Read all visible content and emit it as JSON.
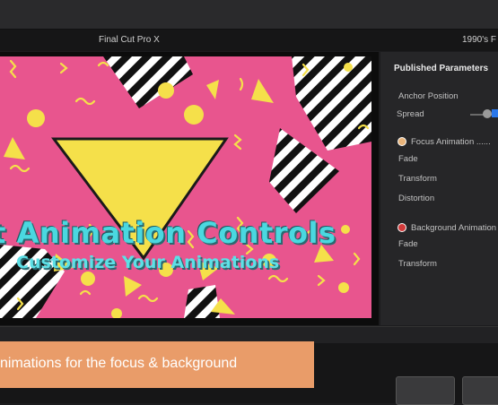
{
  "window": {
    "app_title": "Final Cut Pro X",
    "project_title": "1990's F"
  },
  "viewer": {
    "title": "xt Animation Controls",
    "subtitle": "Customize Your Animations"
  },
  "inspector": {
    "header": "Published Parameters",
    "rows": {
      "anchor_position": "Anchor Position",
      "spread": "Spread",
      "focus_animation": "Focus Animation",
      "focus_fade": "Fade",
      "focus_transform": "Transform",
      "focus_distortion": "Distortion",
      "background_animation": "Background Animation",
      "bg_fade": "Fade",
      "bg_transform": "Transform"
    }
  },
  "caption": {
    "text": "nimations for the focus & background"
  },
  "colors": {
    "canvas_pink": "#e8558e",
    "accent_yellow": "#f5e04a",
    "title_cyan": "#4ad8e0",
    "caption_orange": "#e99c69",
    "accent_blue": "#2b78ea"
  }
}
